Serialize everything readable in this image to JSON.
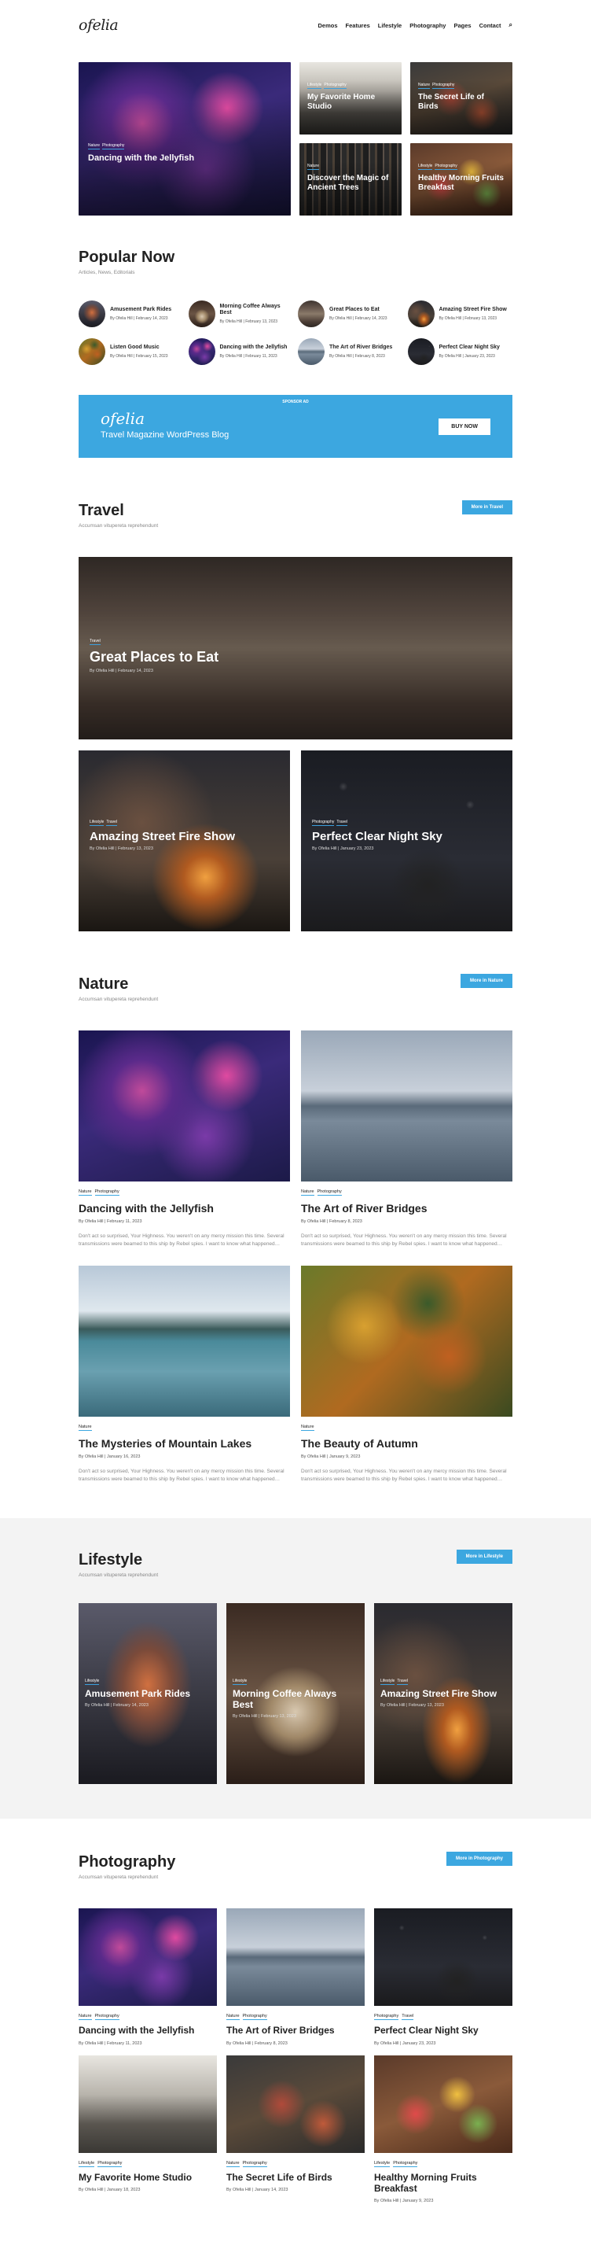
{
  "header": {
    "logo": "ofelia",
    "nav": [
      "Demos",
      "Features",
      "Lifestyle",
      "Photography",
      "Pages",
      "Contact"
    ],
    "search_icon": "search-icon"
  },
  "hero": {
    "big": {
      "tags": [
        "Nature",
        "Photography"
      ],
      "title": "Dancing with the Jellyfish"
    },
    "small": [
      {
        "tags": [
          "Lifestyle",
          "Photography"
        ],
        "title": "My Favorite Home Studio"
      },
      {
        "tags": [
          "Nature",
          "Photography"
        ],
        "title": "The Secret Life of Birds"
      },
      {
        "tags": [
          "Nature"
        ],
        "title": "Discover the Magic of Ancient Trees"
      },
      {
        "tags": [
          "Lifestyle",
          "Photography"
        ],
        "title": "Healthy Morning Fruits Breakfast"
      }
    ]
  },
  "popular": {
    "title": "Popular Now",
    "subtitle": "Articles, News, Editorials",
    "items": [
      {
        "title": "Amusement Park Rides",
        "meta": "By Ofelia Hill | February 14, 2023"
      },
      {
        "title": "Morning Coffee Always Best",
        "meta": "By Ofelia Hill | February 13, 2023"
      },
      {
        "title": "Great Places to Eat",
        "meta": "By Ofelia Hill | February 14, 2023"
      },
      {
        "title": "Amazing Street Fire Show",
        "meta": "By Ofelia Hill | February 13, 2023"
      },
      {
        "title": "Listen Good Music",
        "meta": "By Ofelia Hill | February 15, 2023"
      },
      {
        "title": "Dancing with the Jellyfish",
        "meta": "By Ofelia Hill | February 11, 2023"
      },
      {
        "title": "The Art of River Bridges",
        "meta": "By Ofelia Hill | February 8, 2023"
      },
      {
        "title": "Perfect Clear Night Sky",
        "meta": "By Ofelia Hill | January 23, 2023"
      }
    ]
  },
  "banner": {
    "sponsor": "SPONSOR AD",
    "logo": "ofelia",
    "tagline": "Travel Magazine WordPress Blog",
    "button": "BUY NOW"
  },
  "travel": {
    "title": "Travel",
    "subtitle": "Accumsan vitupereta reprehendunt",
    "more": "More in Travel",
    "big": {
      "tags": [
        "Travel"
      ],
      "title": "Great Places to Eat",
      "meta": "By Ofelia Hill | February 14, 2023"
    },
    "row": [
      {
        "tags": [
          "Lifestyle",
          "Travel"
        ],
        "title": "Amazing Street Fire Show",
        "meta": "By Ofelia Hill | February 13, 2023"
      },
      {
        "tags": [
          "Photography",
          "Travel"
        ],
        "title": "Perfect Clear Night Sky",
        "meta": "By Ofelia Hill | January 23, 2023"
      }
    ]
  },
  "nature": {
    "title": "Nature",
    "subtitle": "Accumsan vitupereta reprehendunt",
    "more": "More in Nature",
    "cards": [
      {
        "tags": [
          "Nature",
          "Photography"
        ],
        "title": "Dancing with the Jellyfish",
        "meta": "By Ofelia Hill | February 11, 2023",
        "excerpt": "Don't act so surprised, Your Highness. You weren't on any mercy mission this time. Several transmissions were beamed to this ship by Rebel spies. I want to know what happened…"
      },
      {
        "tags": [
          "Nature",
          "Photography"
        ],
        "title": "The Art of River Bridges",
        "meta": "By Ofelia Hill | February 8, 2023",
        "excerpt": "Don't act so surprised, Your Highness. You weren't on any mercy mission this time. Several transmissions were beamed to this ship by Rebel spies. I want to know what happened…"
      },
      {
        "tags": [
          "Nature"
        ],
        "title": "The Mysteries of Mountain Lakes",
        "meta": "By Ofelia Hill | January 16, 2023",
        "excerpt": "Don't act so surprised, Your Highness. You weren't on any mercy mission this time. Several transmissions were beamed to this ship by Rebel spies. I want to know what happened…"
      },
      {
        "tags": [
          "Nature"
        ],
        "title": "The Beauty of Autumn",
        "meta": "By Ofelia Hill | January 9, 2023",
        "excerpt": "Don't act so surprised, Your Highness. You weren't on any mercy mission this time. Several transmissions were beamed to this ship by Rebel spies. I want to know what happened…"
      }
    ]
  },
  "lifestyle": {
    "title": "Lifestyle",
    "subtitle": "Accumsan vitupereta reprehendunt",
    "more": "More in Lifestyle",
    "cards": [
      {
        "tags": [
          "Lifestyle"
        ],
        "title": "Amusement Park Rides",
        "meta": "By Ofelia Hill | February 14, 2023"
      },
      {
        "tags": [
          "Lifestyle"
        ],
        "title": "Morning Coffee Always Best",
        "meta": "By Ofelia Hill | February 13, 2023"
      },
      {
        "tags": [
          "Lifestyle",
          "Travel"
        ],
        "title": "Amazing Street Fire Show",
        "meta": "By Ofelia Hill | February 13, 2023"
      }
    ]
  },
  "photography": {
    "title": "Photography",
    "subtitle": "Accumsan vitupereta reprehendunt",
    "more": "More in Photography",
    "cards": [
      {
        "tags": [
          "Nature",
          "Photography"
        ],
        "title": "Dancing with the Jellyfish",
        "meta": "By Ofelia Hill | February 11, 2023"
      },
      {
        "tags": [
          "Nature",
          "Photography"
        ],
        "title": "The Art of River Bridges",
        "meta": "By Ofelia Hill | February 8, 2023"
      },
      {
        "tags": [
          "Photography",
          "Travel"
        ],
        "title": "Perfect Clear Night Sky",
        "meta": "By Ofelia Hill | January 23, 2023"
      },
      {
        "tags": [
          "Lifestyle",
          "Photography"
        ],
        "title": "My Favorite Home Studio",
        "meta": "By Ofelia Hill | January 18, 2023"
      },
      {
        "tags": [
          "Nature",
          "Photography"
        ],
        "title": "The Secret Life of Birds",
        "meta": "By Ofelia Hill | January 14, 2023"
      },
      {
        "tags": [
          "Lifestyle",
          "Photography"
        ],
        "title": "Healthy Morning Fruits Breakfast",
        "meta": "By Ofelia Hill | January 9, 2023"
      }
    ]
  },
  "colors": {
    "accent": "#3ca7e0"
  }
}
